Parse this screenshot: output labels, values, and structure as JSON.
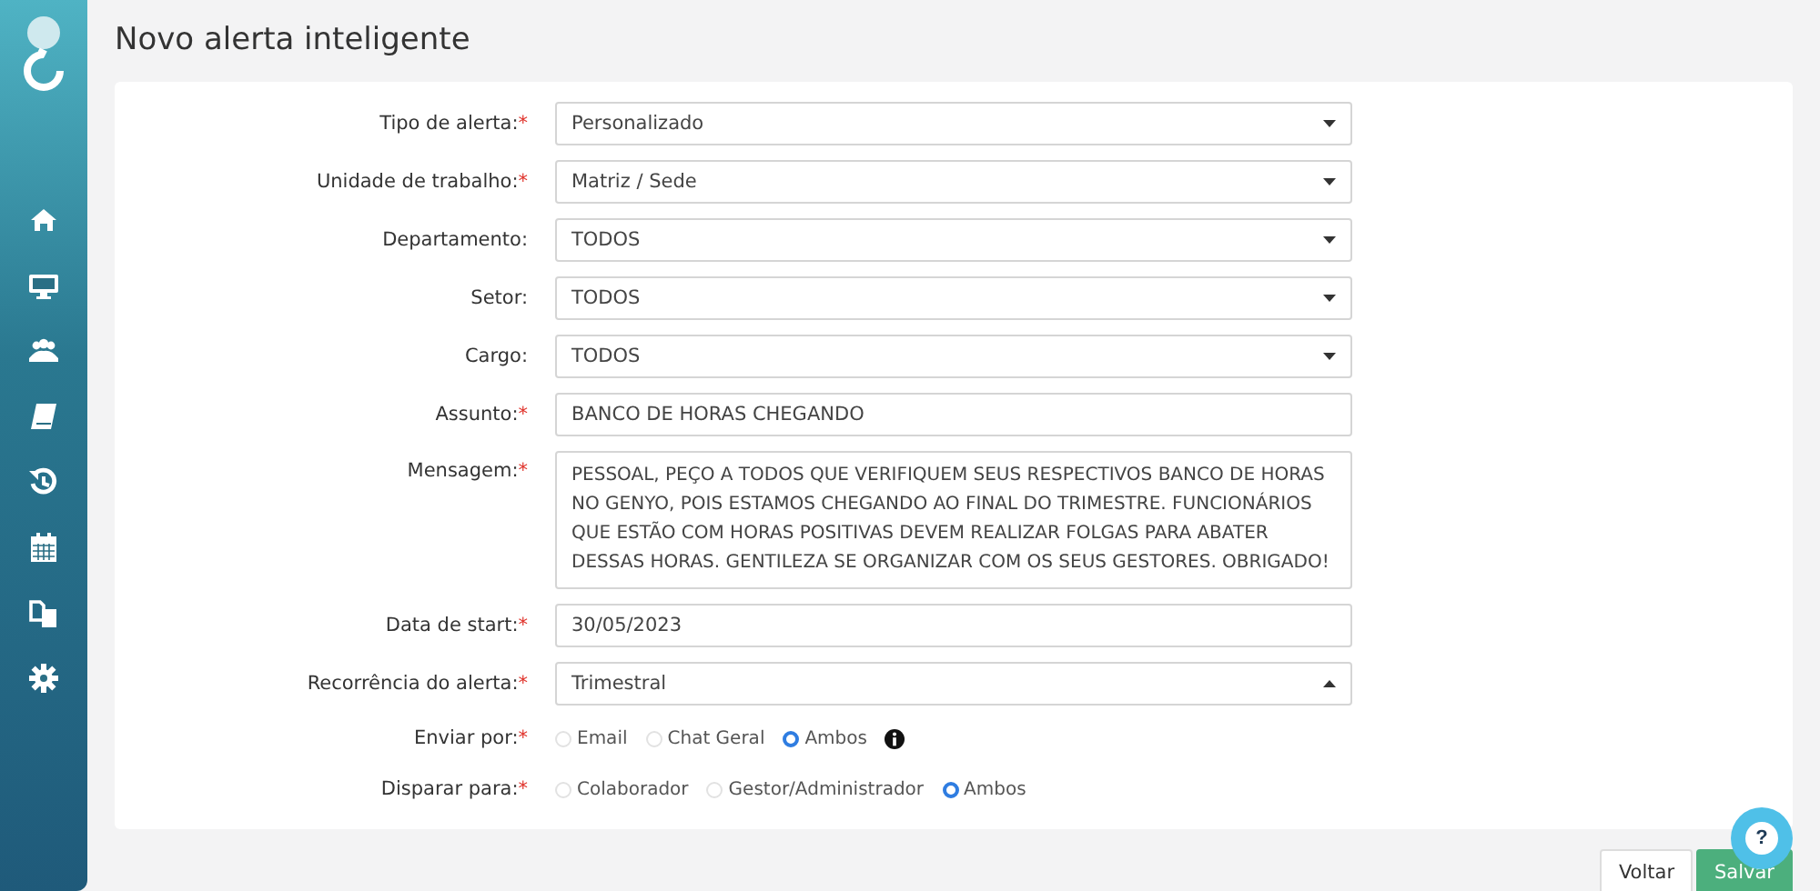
{
  "page_title": "Novo alerta inteligente",
  "form": {
    "fields": [
      {
        "kind": "select",
        "label": "Tipo de alerta:",
        "required_mark": "*",
        "value": "Personalizado",
        "expanded": false
      },
      {
        "kind": "select",
        "label": "Unidade de trabalho:",
        "required_mark": "*",
        "value": "Matriz / Sede",
        "expanded": false
      },
      {
        "kind": "select",
        "label": "Departamento:",
        "value": "TODOS",
        "expanded": false
      },
      {
        "kind": "select",
        "label": "Setor:",
        "value": "TODOS",
        "expanded": false
      },
      {
        "kind": "select",
        "label": "Cargo:",
        "value": "TODOS",
        "expanded": false
      },
      {
        "kind": "text",
        "label": "Assunto:",
        "required_mark": "*",
        "value": "BANCO DE HORAS CHEGANDO"
      },
      {
        "kind": "textarea",
        "label": "Mensagem:",
        "required_mark": "*",
        "value": "PESSOAL, PEÇO A TODOS QUE VERIFIQUEM SEUS RESPECTIVOS BANCO DE HORAS NO GENYO, POIS ESTAMOS CHEGANDO AO FINAL DO TRIMESTRE. FUNCIONÁRIOS QUE ESTÃO COM HORAS POSITIVAS DEVEM REALIZAR FOLGAS PARA ABATER DESSAS HORAS. GENTILEZA SE ORGANIZAR COM OS SEUS GESTORES. OBRIGADO!"
      },
      {
        "kind": "text",
        "label": "Data de start:",
        "required_mark": "*",
        "value": "30/05/2023"
      },
      {
        "kind": "select",
        "label": "Recorrência do alerta:",
        "required_mark": "*",
        "value": "Trimestral",
        "expanded": true
      },
      {
        "kind": "radio",
        "label": "Enviar por:",
        "required_mark": "*",
        "info": true,
        "options": [
          {
            "label": "Email",
            "selected": false
          },
          {
            "label": "Chat Geral",
            "selected": false
          },
          {
            "label": "Ambos",
            "selected": true
          }
        ]
      },
      {
        "kind": "radio",
        "label": "Disparar para:",
        "required_mark": "*",
        "options": [
          {
            "label": "Colaborador",
            "selected": false
          },
          {
            "label": "Gestor/Administrador",
            "selected": false
          },
          {
            "label": "Ambos",
            "selected": true
          }
        ]
      }
    ]
  },
  "buttons": [
    {
      "label": "Voltar",
      "kind": "default"
    },
    {
      "label": "Salvar",
      "kind": "primary"
    }
  ],
  "help_button": {
    "label": "?"
  }
}
